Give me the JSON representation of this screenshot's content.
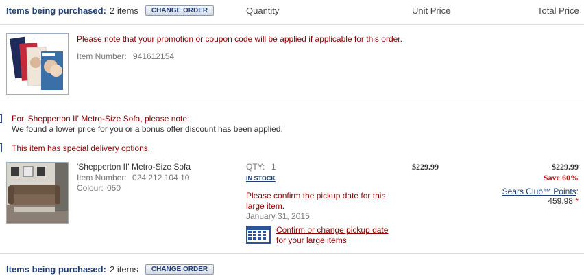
{
  "header_top": {
    "title": "Items being purchased:",
    "count": "2 items",
    "change_order": "CHANGE ORDER",
    "col_quantity": "Quantity",
    "col_unit_price": "Unit Price",
    "col_total_price": "Total Price"
  },
  "promo_item": {
    "image_icon": "magazine-covers-image",
    "note": "Please note that your promotion or coupon code will be applied if applicable for this order.",
    "item_number_label": "Item Number:",
    "item_number": "941612154"
  },
  "sofa_notices": {
    "note_title": "For 'Shepperton II' Metro-Size Sofa, please note:",
    "note_body": "We found a lower price for you or a bonus offer discount has been applied.",
    "delivery_note": "This item has special delivery options."
  },
  "sofa_item": {
    "image_icon": "sofa-image",
    "name": "'Shepperton II' Metro-Size Sofa",
    "item_number_label": "Item Number:",
    "item_number": "024 212 104 10",
    "colour_label": "Colour:",
    "colour": "050",
    "qty_label": "QTY:",
    "qty": "1",
    "stock_status": "IN STOCK",
    "unit_price": "$229.99",
    "total_price": "$229.99",
    "savings": "Save 60%",
    "club_label": "Sears Club™ Points",
    "club_colon": ":",
    "points": "459.98",
    "points_marker": "*",
    "pickup_note_line1": "Please confirm the pickup date for this",
    "pickup_note_line2": "large item.",
    "pickup_date": "January 31, 2015",
    "calendar_icon": "calendar-icon",
    "pickup_link_line1": "Confirm or change pickup date",
    "pickup_link_line2": "for your large items"
  },
  "header_bottom": {
    "title": "Items being purchased:",
    "count": "2 items",
    "change_order": "CHANGE ORDER"
  },
  "colors": {
    "heading_blue": "#1f3e73",
    "notice_red": "#8b0000",
    "save_red": "#b22222"
  }
}
